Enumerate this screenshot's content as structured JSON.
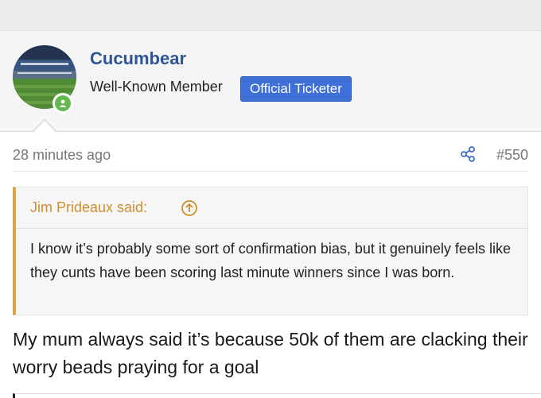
{
  "user": {
    "name": "Cucumbear",
    "title": "Well-Known Member",
    "badge": "Official Ticketer"
  },
  "post": {
    "time": "28 minutes ago",
    "number": "#550",
    "body": "My mum always said it’s because 50k of them are clacking their worry beads praying for a goal"
  },
  "quote": {
    "author": "Jim Prideaux said:",
    "text": "I know it’s probably some sort of confirmation bias, but it genuinely feels like they cunts have been scoring last minute winners since I was born."
  },
  "icons": {
    "share": "share-icon",
    "quote_jump": "arrow-up-circle-icon",
    "online": "online-user-icon"
  },
  "colors": {
    "username": "#2f5596",
    "badge_bg": "#3f6fd8",
    "quote_accent": "#e0a23f",
    "online": "#63b94f"
  }
}
